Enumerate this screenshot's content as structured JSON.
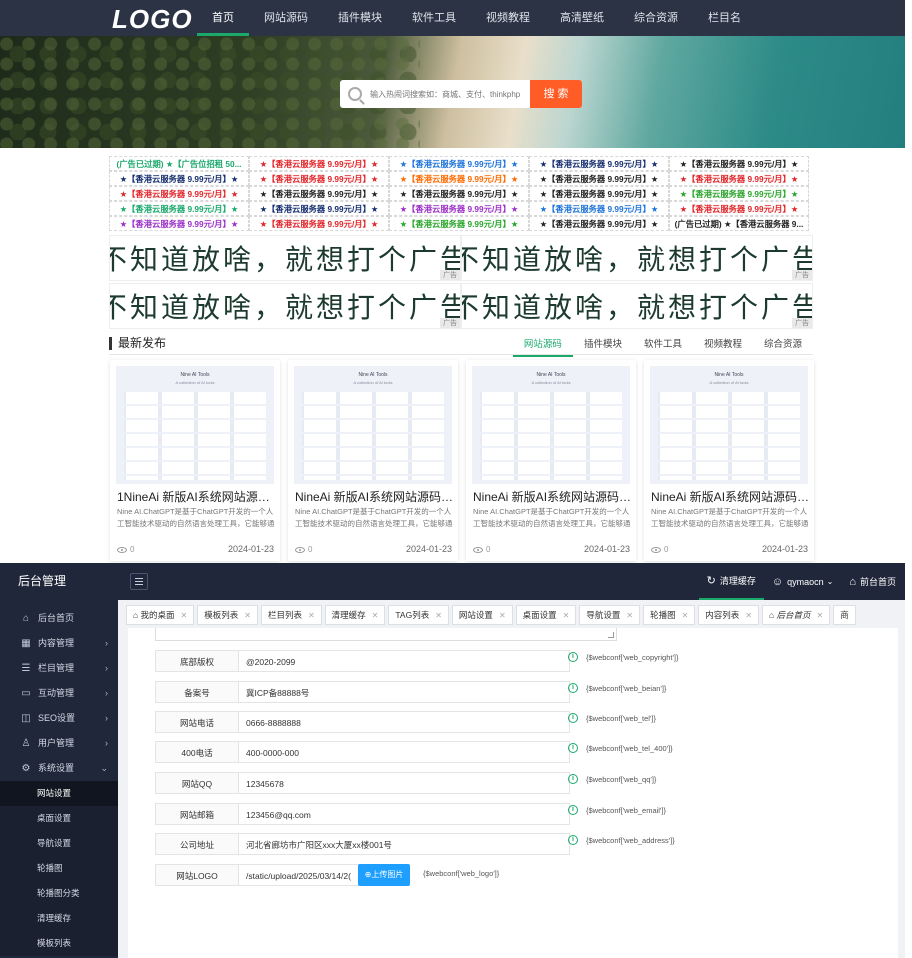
{
  "site": {
    "logo": "LOGO",
    "nav": [
      "首页",
      "网站源码",
      "插件模块",
      "软件工具",
      "视频教程",
      "高清壁纸",
      "综合资源",
      "栏目名"
    ],
    "search_placeholder": "输入热闹词搜索如：商城、支付、thinkphp",
    "search_button": "搜 索",
    "ads": [
      {
        "text": "(广告已过期) ★【广告位招租 50...",
        "color": "#1aa86b"
      },
      {
        "text": "★【香港云服务器 9.99元/月】★",
        "color": "#e0262a"
      },
      {
        "text": "★【香港云服务器 9.99元/月】★",
        "color": "#1e73d8"
      },
      {
        "text": "★【香港云服务器 9.99元/月】★",
        "color": "#152e6e"
      },
      {
        "text": "★【香港云服务器 9.99元/月】★",
        "color": "#222222"
      },
      {
        "text": "★【香港云服务器 9.99元/月】★",
        "color": "#152e6e"
      },
      {
        "text": "★【香港云服务器 9.99元/月】★",
        "color": "#e0262a"
      },
      {
        "text": "★【香港云服务器 9.99元/月】★",
        "color": "#ff6a00"
      },
      {
        "text": "★【香港云服务器 9.99元/月】★",
        "color": "#222222"
      },
      {
        "text": "★【香港云服务器 9.99元/月】★",
        "color": "#e0262a"
      },
      {
        "text": "★【香港云服务器 9.99元/月】★",
        "color": "#e0262a"
      },
      {
        "text": "★【香港云服务器 9.99元/月】★",
        "color": "#222222"
      },
      {
        "text": "★【香港云服务器 9.99元/月】★",
        "color": "#222222"
      },
      {
        "text": "★【香港云服务器 9.99元/月】★",
        "color": "#222222"
      },
      {
        "text": "★【香港云服务器 9.99元/月】★",
        "color": "#2aa52a"
      },
      {
        "text": "★【香港云服务器 9.99元/月】★",
        "color": "#1aa86b"
      },
      {
        "text": "★【香港云服务器 9.99元/月】★",
        "color": "#152e6e"
      },
      {
        "text": "★【香港云服务器 9.99元/月】★",
        "color": "#9b2fc7"
      },
      {
        "text": "★【香港云服务器 9.99元/月】★",
        "color": "#1e73d8"
      },
      {
        "text": "★【香港云服务器 9.99元/月】★",
        "color": "#e0262a"
      },
      {
        "text": "★【香港云服务器 9.99元/月】★",
        "color": "#9b2fc7"
      },
      {
        "text": "★【香港云服务器 9.99元/月】★",
        "color": "#e0262a"
      },
      {
        "text": "★【香港云服务器 9.99元/月】★",
        "color": "#2aa52a"
      },
      {
        "text": "★【香港云服务器 9.99元/月】★",
        "color": "#222222"
      },
      {
        "text": "(广告已过期) ★【香港云服务器 9...",
        "color": "#222222"
      }
    ],
    "banners": [
      {
        "text": "不知道放啥，就想打个广告",
        "tag": "广告"
      },
      {
        "text": "不知道放啥，就想打个广告",
        "tag": "广告"
      },
      {
        "text": "不知道放啥，就想打个广告",
        "tag": "广告"
      },
      {
        "text": "不知道放啥，就想打个广告",
        "tag": "广告"
      }
    ],
    "latest": {
      "title": "最新发布",
      "tabs": [
        "网站源码",
        "插件模块",
        "软件工具",
        "视频教程",
        "综合资源"
      ],
      "cards": [
        {
          "title": "1NineAi 新版AI系统网站源码 ...",
          "desc": "Nine AI.ChatGPT是基于ChatGPT开发的一个人工智能技术驱动的自然语言处理工具，它能够通过学",
          "views": "0",
          "date": "2024-01-23",
          "thumb_title": "Nine AI Tools",
          "thumb_sub": "A collection of AI tools"
        },
        {
          "title": "NineAi 新版AI系统网站源码 C...",
          "desc": "Nine AI.ChatGPT是基于ChatGPT开发的一个人工智能技术驱动的自然语言处理工具，它能够通过学",
          "views": "0",
          "date": "2024-01-23",
          "thumb_title": "Nine AI Tools",
          "thumb_sub": "A collection of AI tools"
        },
        {
          "title": "NineAi 新版AI系统网站源码 C...",
          "desc": "Nine AI.ChatGPT是基于ChatGPT开发的一个人工智能技术驱动的自然语言处理工具，它能够通过学",
          "views": "0",
          "date": "2024-01-23",
          "thumb_title": "Nine AI Tools",
          "thumb_sub": "A collection of AI tools"
        },
        {
          "title": "NineAi 新版AI系统网站源码 C...",
          "desc": "Nine AI.ChatGPT是基于ChatGPT开发的一个人工智能技术驱动的自然语言处理工具，它能够通过学",
          "views": "0",
          "date": "2024-01-23",
          "thumb_title": "Nine AI Tools",
          "thumb_sub": "A collection of AI tools"
        }
      ]
    }
  },
  "admin": {
    "brand": "后台管理",
    "top_right": {
      "clear_cache": "清理缓存",
      "user": "qymaocn",
      "front": "前台首页"
    },
    "sidebar": [
      {
        "label": "后台首页",
        "icon": "home-icon",
        "arrow": false
      },
      {
        "label": "内容管理",
        "icon": "grid-icon",
        "arrow": true
      },
      {
        "label": "栏目管理",
        "icon": "list-icon",
        "arrow": true
      },
      {
        "label": "互动管理",
        "icon": "chat-icon",
        "arrow": true
      },
      {
        "label": "SEO设置",
        "icon": "seo-icon",
        "arrow": true
      },
      {
        "label": "用户管理",
        "icon": "user-icon",
        "arrow": true
      },
      {
        "label": "系统设置",
        "icon": "gear-icon",
        "arrow": true
      }
    ],
    "sub_items": [
      "网站设置",
      "桌面设置",
      "导航设置",
      "轮播图",
      "轮播图分类",
      "清理缓存",
      "模板列表"
    ],
    "tabs": [
      "我的桌面",
      "模板列表",
      "栏目列表",
      "清理缓存",
      "TAG列表",
      "网站设置",
      "桌面设置",
      "导航设置",
      "轮播图",
      "内容列表",
      "后台首页",
      "商"
    ],
    "form": [
      {
        "label": "底部版权",
        "value": "@2020-2099",
        "hint": "{$webconf['web_copyright']}"
      },
      {
        "label": "备案号",
        "value": "冀ICP备88888号",
        "hint": "{$webconf['web_beian']}"
      },
      {
        "label": "网站电话",
        "value": "0666-8888888",
        "hint": "{$webconf['web_tel']}"
      },
      {
        "label": "400电话",
        "value": "400-0000-000",
        "hint": "{$webconf['web_tel_400']}"
      },
      {
        "label": "网站QQ",
        "value": "12345678",
        "hint": "{$webconf['web_qq']}"
      },
      {
        "label": "网站邮箱",
        "value": "123456@qq.com",
        "hint": "{$webconf['web_email']}"
      },
      {
        "label": "公司地址",
        "value": "河北省廊坊市广阳区xxx大厦xx楼001号",
        "hint": "{$webconf['web_address']}"
      }
    ],
    "logo_row": {
      "label": "网站LOGO",
      "value": "/static/upload/2025/03/14/2(",
      "button": "上传图片",
      "hint": "{$webconf['web_logo']}"
    }
  }
}
